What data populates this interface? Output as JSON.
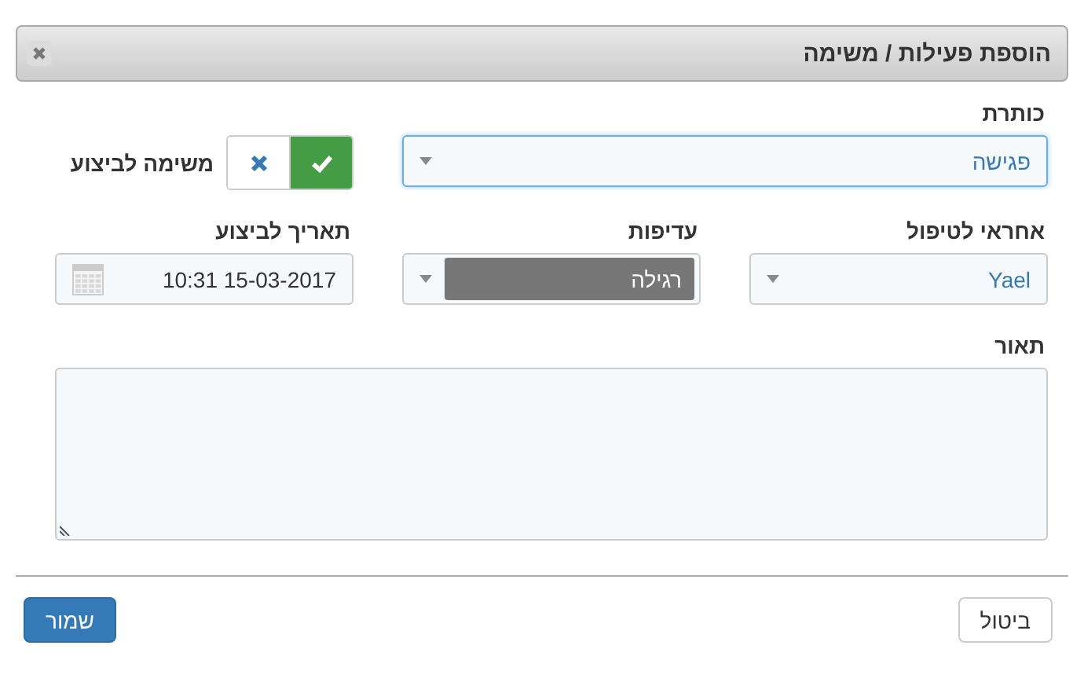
{
  "dialog": {
    "title": "הוספת פעילות / משימה"
  },
  "title_field": {
    "label": "כותרת",
    "value": "פגישה"
  },
  "task_toggle": {
    "label": "משימה לביצוע",
    "on": true
  },
  "assignee": {
    "label": "אחראי לטיפול",
    "value": "Yael"
  },
  "priority": {
    "label": "עדיפות",
    "value": "רגילה"
  },
  "due_date": {
    "label": "תאריך לביצוע",
    "value": "10:31 15-03-2017"
  },
  "description": {
    "label": "תאור"
  },
  "buttons": [
    {
      "label": "ביטול",
      "kind": "default"
    },
    {
      "label": "שמור",
      "kind": "primary"
    }
  ]
}
